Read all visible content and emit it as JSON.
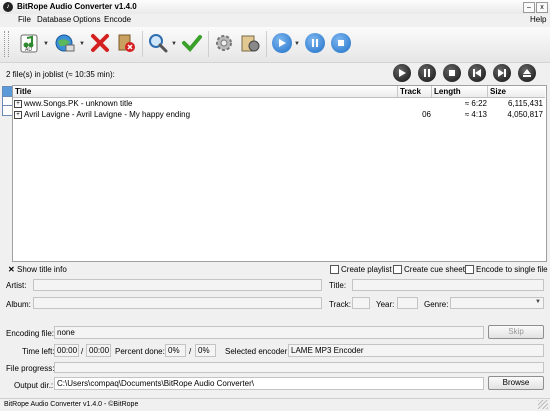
{
  "window": {
    "title": "BitRope Audio Converter v1.4.0",
    "app_icon_glyph": "♪"
  },
  "menu": [
    "File",
    "Database",
    "Options",
    "Encode"
  ],
  "menu_help": "Help",
  "toolbar_icons": [
    "add-audio-icon",
    "add-url-icon",
    "remove-icon",
    "clear-list-icon",
    "search-icon",
    "check-icon",
    "settings-gear-icon",
    "plugin-icon",
    "play-icon",
    "pause-icon",
    "stop-icon"
  ],
  "joblist": {
    "info": "2 file(s) in joblist (≈ 10:35 min):"
  },
  "columns": [
    "Title",
    "Track",
    "Length",
    "Size"
  ],
  "rows": [
    {
      "title": "www.Songs.PK - unknown title",
      "track": "",
      "length": "≈ 6:22",
      "size": "6,115,431"
    },
    {
      "title": "Avril Lavigne - Avril Lavigne - My happy ending",
      "track": "06",
      "length": "≈ 4:13",
      "size": "4,050,817"
    }
  ],
  "title_info": {
    "show_label": "Show title info",
    "create_playlist": "Create playlist",
    "create_cue": "Create cue sheet",
    "encode_single": "Encode to single file",
    "artist": "Artist:",
    "title": "Title:",
    "album": "Album:",
    "track": "Track:",
    "year": "Year:",
    "genre": "Genre:"
  },
  "encoding": {
    "file_label": "Encoding file:",
    "file_value": "none",
    "skip": "Skip",
    "time_left_label": "Time left:",
    "time_left": "00:00",
    "time_total": "00:00",
    "percent_label": "Percent done:",
    "percent": "0%",
    "percent_total": "0%",
    "encoder_label": "Selected encoder:",
    "encoder": "LAME MP3 Encoder",
    "progress_label": "File progress:",
    "output_label": "Output dir.:",
    "output_dir": "C:\\Users\\compaq\\Documents\\BitRope Audio Converter\\",
    "browse": "Browse"
  },
  "status": "BitRope Audio Converter v1.4.0 - ©BitRope",
  "colors": {
    "play_buttons": "#1e6fc7",
    "remove": "#d42020",
    "check": "#3aa02a"
  }
}
